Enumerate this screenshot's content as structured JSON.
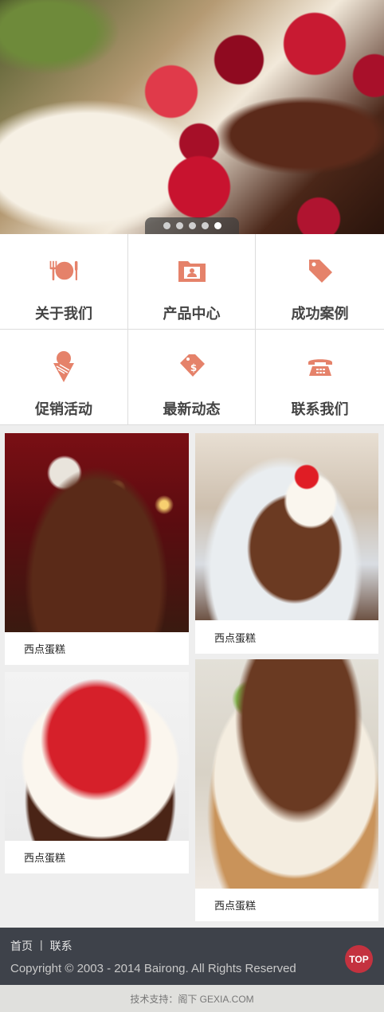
{
  "hero": {
    "slide_count": 5,
    "active_slide": 5
  },
  "nav": {
    "items": [
      {
        "label": "关于我们",
        "icon": "utensils-plate-icon"
      },
      {
        "label": "产品中心",
        "icon": "folder-user-icon"
      },
      {
        "label": "成功案例",
        "icon": "tag-icon"
      },
      {
        "label": "促销活动",
        "icon": "ice-cream-icon"
      },
      {
        "label": "最新动态",
        "icon": "price-tag-dollar-icon"
      },
      {
        "label": "联系我们",
        "icon": "telephone-icon"
      }
    ]
  },
  "products": [
    {
      "caption": "西点蛋糕"
    },
    {
      "caption": "西点蛋糕"
    },
    {
      "caption": "西点蛋糕"
    },
    {
      "caption": "西点蛋糕"
    }
  ],
  "footer": {
    "links": [
      "首页",
      "联系"
    ],
    "separator": "|",
    "copyright": "Copyright © 2003 - 2014 Bairong. All Rights Reserved",
    "top_button": "TOP",
    "support": "技术支持：阁下 GEXIA.COM"
  },
  "colors": {
    "accent_icon": "#e5826a",
    "footer_bg": "#3e424a",
    "top_button": "#c4323f"
  }
}
